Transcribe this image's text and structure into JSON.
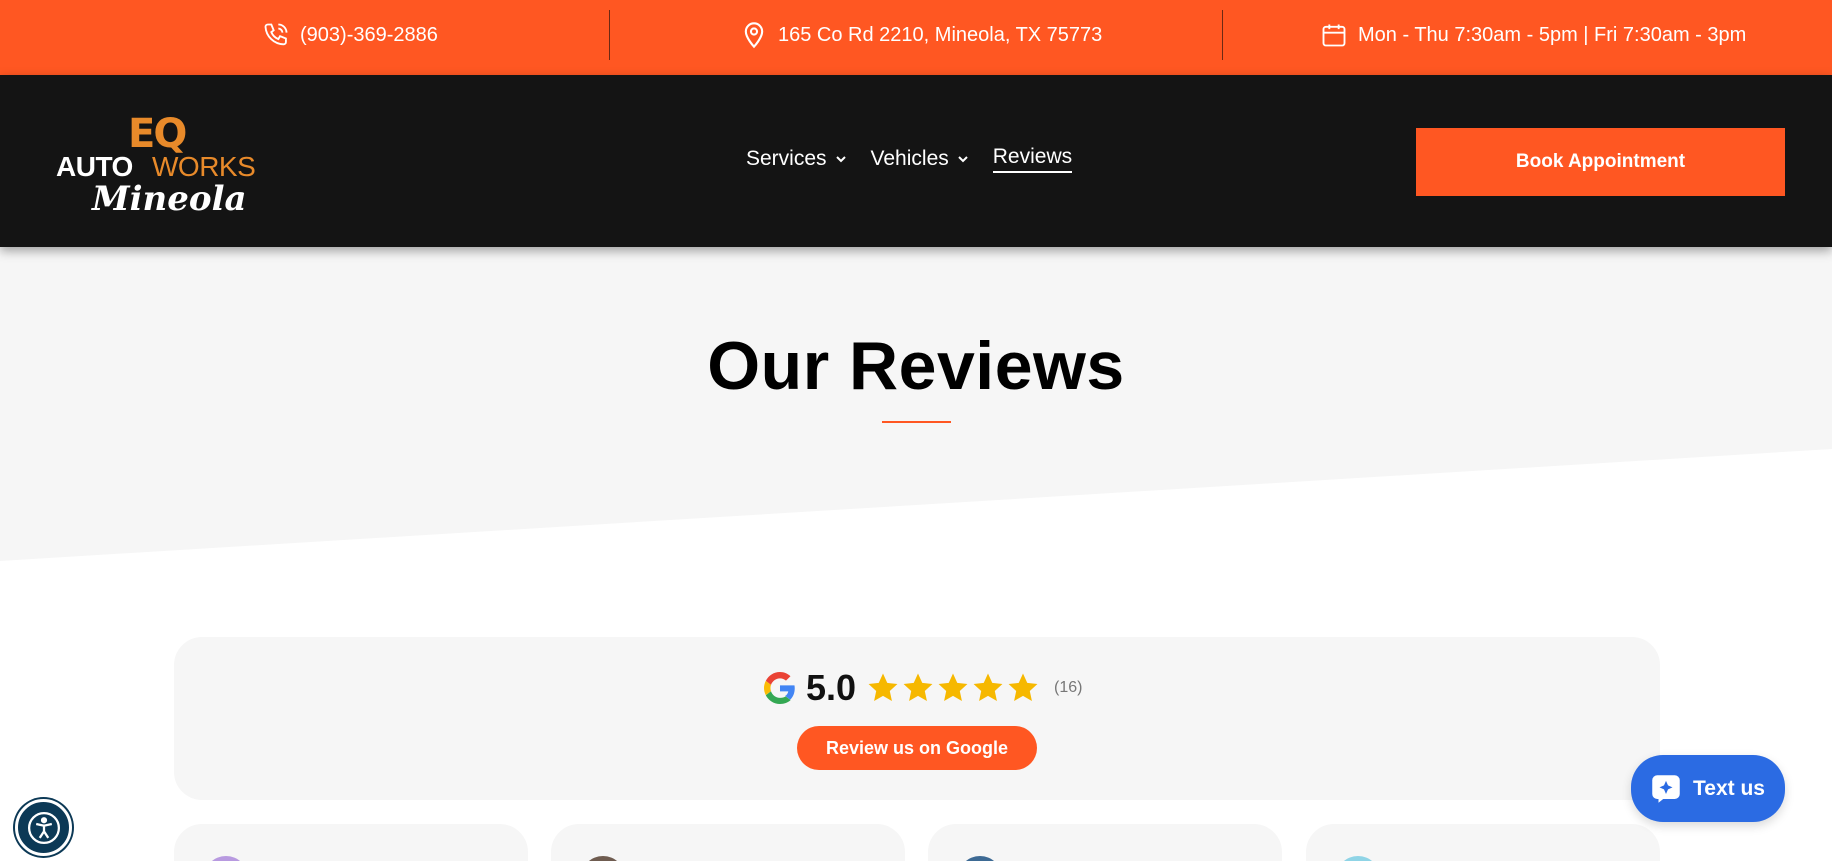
{
  "topbar": {
    "phone": "(903)-369-2886",
    "address": "165 Co Rd 2210, Mineola, TX 75773",
    "hours": "Mon - Thu 7:30am - 5pm | Fri 7:30am - 3pm",
    "icons": [
      "phone-icon",
      "map-pin-icon",
      "calendar-icon"
    ]
  },
  "header": {
    "logo": {
      "eq": "EQ",
      "auto": "AUTO",
      "works": "WORKS",
      "city": "Mineola"
    },
    "nav": [
      {
        "label": "Services",
        "has_dropdown": true
      },
      {
        "label": "Vehicles",
        "has_dropdown": true
      },
      {
        "label": "Reviews",
        "has_dropdown": false,
        "active": true
      }
    ],
    "book_label": "Book Appointment"
  },
  "hero": {
    "title": "Our Reviews"
  },
  "summary": {
    "score": "5.0",
    "stars": 5,
    "count": "(16)",
    "button_label": "Review us on Google"
  },
  "cards": [
    {
      "name": "",
      "avatar_color": "#b89ae0"
    },
    {
      "name": "",
      "avatar_color": "#6f5c50"
    },
    {
      "name": "",
      "avatar_color": "#3d6a94"
    },
    {
      "name": "",
      "avatar_color": "#8fd4e6"
    }
  ],
  "widgets": {
    "text_us": "Text us"
  },
  "colors": {
    "accent": "#ff5722",
    "header_bg": "#141414",
    "logo_orange": "#e88a2a",
    "star": "#f6b800",
    "chat_blue": "#2b6be3",
    "accessibility": "#0c3956"
  }
}
